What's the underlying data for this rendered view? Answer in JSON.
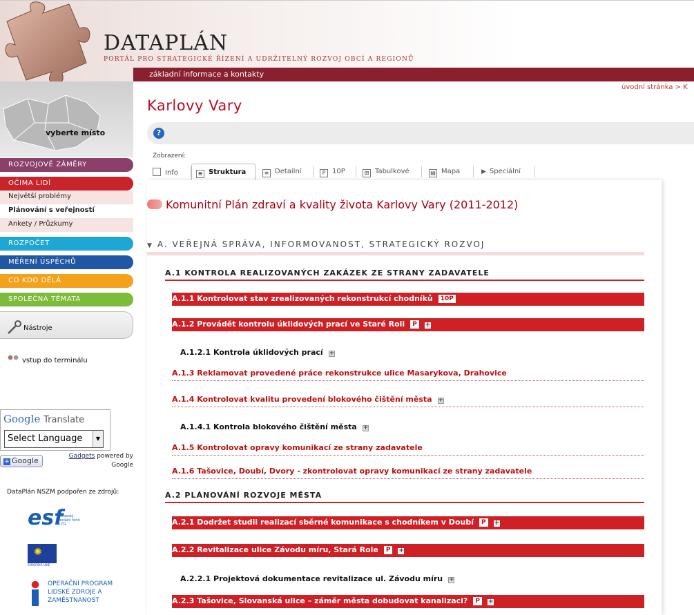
{
  "header": {
    "logo": "DATAPLÁN",
    "tagline": "PORTÁL PRO STRATEGICKÉ ŘÍZENÍ A UDRŽITELNÝ ROZVOJ OBCÍ A REGIONŮ",
    "topbar_link": "základní informace a kontakty"
  },
  "left": {
    "pick_place": "vyberte místo",
    "nav": [
      {
        "label": "ROZVOJOVÉ ZÁMĚRY",
        "color": "#8b3f6b"
      },
      {
        "label": "OČIMA LIDÍ",
        "color": "#c9232c"
      },
      {
        "label": "ROZPOČET",
        "color": "#1ea6d4"
      },
      {
        "label": "MĚŘENÍ ÚSPĚCHŮ",
        "color": "#1f57a5"
      },
      {
        "label": "CO KDO DĚLÁ",
        "color": "#f4a21b"
      },
      {
        "label": "SPOLEČNÁ TÉMATA",
        "color": "#7dbb3a"
      }
    ],
    "sub_items": [
      "Největší problémy",
      "Plánování s veřejností",
      "Ankety / Průzkumy"
    ],
    "tools": "Nástroje",
    "terminal": "vstup do terminálu",
    "translate": {
      "google": "Google",
      "translate": "Translate",
      "select": "Select Language",
      "button": "Google",
      "gadgets": "Gadgets",
      "powered": "powered by",
      "google2": "Google"
    },
    "support": "DataPlán NSZM podpořen ze zdrojů:",
    "esf_text": "evropský sociální fond v ČR",
    "eu_text": "EVROPSKÁ UNIE",
    "op_text": "OPERAČNÍ PROGRAM LIDSKÉ ZDROJE A ZAMĚSTNANOST"
  },
  "main": {
    "breadcrumb": "úvodní stránka > K",
    "title": "Karlovy Vary",
    "view_label": "Zobrazení:",
    "tabs": [
      "Info",
      "Struktura",
      "Detailní",
      "10P",
      "Tabulkové",
      "Mapa",
      "Speciální"
    ],
    "plan_title": "Komunitní Plán zdraví a kvality života Karlovy Vary (2011-2012)",
    "section_a": "A. VEŘEJNÁ SPRÁVA, INFORMOVANOST, STRATEGICKÝ ROZVOJ",
    "a1": "A.1 KONTROLA REALIZOVANÝCH ZAKÁZEK ZE STRANY ZADAVATELE",
    "a11": "A.1.1 Kontrolovat stav zrealizovaných rekonstrukcí chodníků",
    "a11_badge": "10P",
    "a12": "A.1.2 Provádět kontrolu úklidových prací ve Staré Roli",
    "a121": "A.1.2.1 Kontrola úklidových prací",
    "a13": "A.1.3 Reklamovat provedené práce rekonstrukce ulice Masarykova, Drahovice",
    "a14": "A.1.4 Kontrolovat kvalitu provedení blokového čištění města",
    "a141": "A.1.4.1 Kontrola blokového čištění města",
    "a15": "A.1.5 Kontrolovat opravy komunikací ze strany zadavatele",
    "a16": "A.1.6 Tašovice, Doubí, Dvory - zkontrolovat opravy komunikací ze strany zadavatele",
    "a2": "A.2 PLÁNOVÁNÍ ROZVOJE MĚSTA",
    "a21": "A.2.1 Dodržet studii realizací sběrné komunikace s chodníkem v Doubí",
    "a22": "A.2.2 Revitalizace ulice Závodu míru, Stará Role",
    "a221": "A.2.2.1 Projektová dokumentace revitalizace ul. Závodu míru",
    "a23": "A.2.3 Tašovice, Slovanská ulice – záměr města dobudovat kanalizaci?",
    "p_badge": "P",
    "plus": "+"
  }
}
